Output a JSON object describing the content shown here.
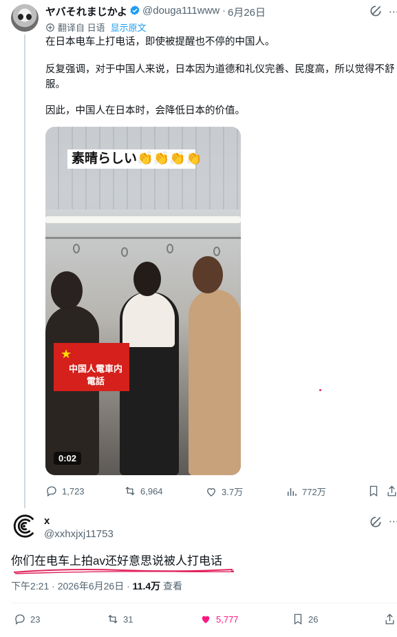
{
  "tweet": {
    "author_name": "ヤバそれまじかよ",
    "handle": "@douga111www",
    "separator": "·",
    "date": "6月26日",
    "translated_label": "翻译自 日语",
    "show_original": "显示原文",
    "paragraphs": [
      "在日本电车上打电话，即使被提醒也不停的中国人。",
      "反复强调，对于中国人来说，日本因为道德和礼仪完善、民度高，所以觉得不舒服。",
      "因此，中国人在日本时，会降低日本的价值。"
    ],
    "video": {
      "subtitle": "素晴らしい👏👏👏👏",
      "flag_caption_line1": "中国人電車内",
      "flag_caption_line2": "電話",
      "duration": "0:02"
    },
    "stats": {
      "replies": "1,723",
      "retweets": "6,964",
      "likes": "3.7万",
      "views": "772万"
    }
  },
  "reply": {
    "author_name": "x",
    "handle": "@xxhxjxj11753",
    "text": "你们在电车上拍av还好意思说被人打电话",
    "time": "下午2:21 · 2026年6月26日 · ",
    "views_count": "11.4万",
    "views_label": "查看",
    "stats": {
      "replies": "23",
      "retweets": "31",
      "likes": "5,777",
      "bookmarks": "26"
    }
  },
  "colors": {
    "text": "#0f1419",
    "secondary": "#536471",
    "link": "#1d9bf0",
    "like_pink": "#f91880",
    "verified": "#1d9bf0",
    "underline_red": "#e0245e"
  }
}
